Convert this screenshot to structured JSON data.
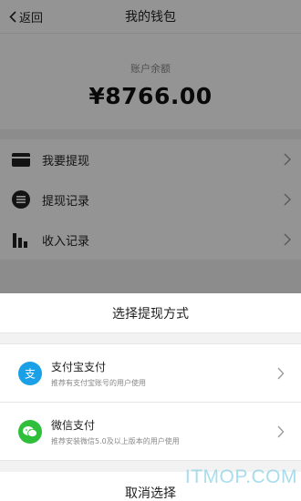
{
  "header": {
    "back_label": "返回",
    "title": "我的钱包"
  },
  "balance": {
    "label": "账户余额",
    "amount": "¥8766.00"
  },
  "menu": {
    "items": [
      {
        "label": "我要提现",
        "icon": "card-icon"
      },
      {
        "label": "提现记录",
        "icon": "list-circle-icon"
      },
      {
        "label": "收入记录",
        "icon": "bar-chart-icon"
      }
    ]
  },
  "sheet": {
    "title": "选择提现方式",
    "options": [
      {
        "name": "支付宝支付",
        "desc": "推荐有支付宝账号的用户使用",
        "icon": "alipay-icon",
        "color": "#1aa0e6"
      },
      {
        "name": "微信支付",
        "desc": "推荐安装微信5.0及以上版本的用户使用",
        "icon": "wechat-icon",
        "color": "#2fbf3a"
      }
    ],
    "cancel_label": "取消选择"
  },
  "watermark": "ITMOP.COM"
}
